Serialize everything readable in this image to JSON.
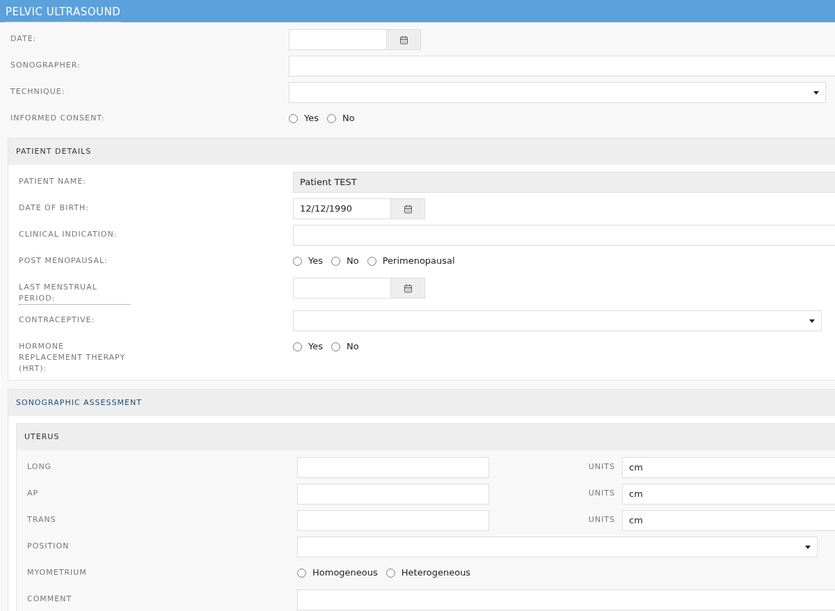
{
  "header": {
    "title": "PELVIC ULTRASOUND"
  },
  "fields": [
    {
      "kind": "date",
      "label": "DATE:"
    },
    {
      "kind": "text",
      "label": "SONOGRAPHER:"
    },
    {
      "kind": "select",
      "label": "TECHNIQUE:"
    },
    {
      "kind": "radio",
      "label": "INFORMED CONSENT:",
      "options": [
        {
          "label": "Yes",
          "selected": false
        },
        {
          "label": "No",
          "selected": false
        }
      ]
    }
  ],
  "patient_details": {
    "title": "PATIENT DETAILS",
    "fields": [
      {
        "kind": "readonly",
        "label": "PATIENT NAME:",
        "value": "Patient TEST"
      },
      {
        "kind": "date",
        "label": "DATE OF BIRTH:",
        "value": "12/12/1990"
      },
      {
        "kind": "text",
        "label": "CLINICAL INDICATION:"
      },
      {
        "kind": "radio",
        "label": "POST MENOPAUSAL:",
        "options": [
          {
            "label": "Yes",
            "selected": false
          },
          {
            "label": "No",
            "selected": false
          },
          {
            "label": "Perimenopausal",
            "selected": false
          }
        ]
      },
      {
        "kind": "date",
        "label": "LAST MENSTRUAL PERIOD:",
        "tooltip": true
      },
      {
        "kind": "select",
        "label": "CONTRACEPTIVE:"
      },
      {
        "kind": "radio",
        "label": "HORMONE REPLACEMENT THERAPY (HRT):",
        "options": [
          {
            "label": "Yes",
            "selected": false
          },
          {
            "label": "No",
            "selected": false
          }
        ]
      }
    ]
  },
  "sonographic_assessment": {
    "title": "SONOGRAPHIC ASSESSMENT",
    "sections": [
      {
        "title": "UTERUS",
        "fields": [
          {
            "kind": "measure",
            "label": "LONG",
            "units_label": "UNITS",
            "units_value": "cm"
          },
          {
            "kind": "measure",
            "label": "AP",
            "units_label": "UNITS",
            "units_value": "cm"
          },
          {
            "kind": "measure",
            "label": "TRANS",
            "units_label": "UNITS",
            "units_value": "cm"
          },
          {
            "kind": "select",
            "label": "POSITION"
          },
          {
            "kind": "radio",
            "label": "MYOMETRIUM",
            "options": [
              {
                "label": "Homogeneous",
                "selected": false
              },
              {
                "label": "Heterogeneous",
                "selected": false
              }
            ]
          },
          {
            "kind": "text",
            "label": "COMMENT"
          }
        ]
      }
    ]
  }
}
